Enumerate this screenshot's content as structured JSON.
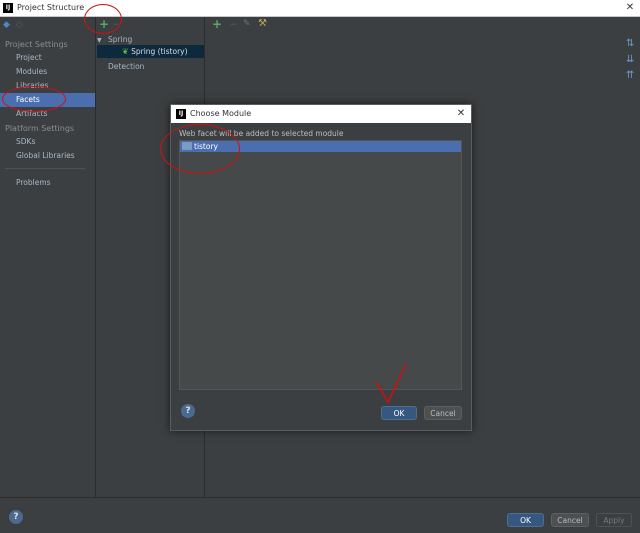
{
  "window": {
    "title": "Project Structure",
    "app_icon": "IJ",
    "close_glyph": "✕"
  },
  "sidebar": {
    "project_settings_header": "Project Settings",
    "items_project": [
      "Project",
      "Modules",
      "Libraries",
      "Facets",
      "Artifacts"
    ],
    "selected": "Facets",
    "platform_settings_header": "Platform Settings",
    "items_platform": [
      "SDKs",
      "Global Libraries"
    ],
    "problems": "Problems"
  },
  "facet_tree": {
    "group": "Spring",
    "child": "Spring (tistory)",
    "detection": "Detection"
  },
  "dialog": {
    "title": "Choose Module",
    "icon": "IJ",
    "message": "Web facet will be added to selected module",
    "modules": [
      "tistory"
    ],
    "ok_label": "OK",
    "cancel_label": "Cancel"
  },
  "footer": {
    "ok_label": "OK",
    "cancel_label": "Cancel",
    "apply_label": "Apply"
  },
  "icons": {
    "add": "+",
    "remove": "−",
    "edit": "✎",
    "back": "◆",
    "forward": "◇",
    "help": "?",
    "expand": "▼",
    "leaf": "❦",
    "tool": "⚒",
    "sort_glyphs": [
      "⇅",
      "⇊",
      "⇈"
    ]
  },
  "colors": {
    "accent": "#4b6eaf",
    "add_green": "#59a869",
    "annotation_red": "#d01010"
  }
}
